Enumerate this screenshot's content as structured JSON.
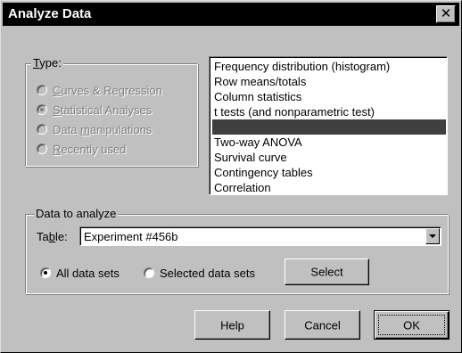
{
  "window": {
    "title": "Analyze Data",
    "close_glyph": "✕"
  },
  "type_group": {
    "legend_prefix": "",
    "legend_mnemonic": "T",
    "legend_rest": "ype:",
    "options": [
      {
        "mnemonic": "C",
        "rest": "urves & Regression",
        "checked": false,
        "enabled": false
      },
      {
        "mnemonic": "S",
        "rest": "tatistical Analyses",
        "checked": true,
        "enabled": false
      },
      {
        "pre": "Data ",
        "mnemonic": "m",
        "rest": "anipulations",
        "checked": false,
        "enabled": false
      },
      {
        "mnemonic": "R",
        "rest": "ecently used",
        "checked": false,
        "enabled": false
      }
    ]
  },
  "analysis_list": {
    "items": [
      "Frequency distribution (histogram)",
      "Row means/totals",
      "Column statistics",
      "t tests (and nonparametric test)",
      "",
      "Two-way ANOVA",
      "Survival curve",
      "Contingency tables",
      "Correlation"
    ],
    "selected_index": 4
  },
  "data_group": {
    "legend": "Data to analyze",
    "table_label_pre": "Ta",
    "table_label_mnemonic": "b",
    "table_label_rest": "le:",
    "table_value": "Experiment #456b",
    "all_sets_label": "All data sets",
    "selected_sets_label": "Selected data sets",
    "all_sets_checked": true,
    "select_button": "Select"
  },
  "buttons": {
    "help": "Help",
    "cancel": "Cancel",
    "ok": "OK"
  },
  "colors": {
    "face": "#c0c0c0",
    "title_bg": "#000000",
    "selection": "#404040"
  },
  "icons": {
    "close": "close-icon",
    "dropdown": "chevron-down-icon"
  }
}
